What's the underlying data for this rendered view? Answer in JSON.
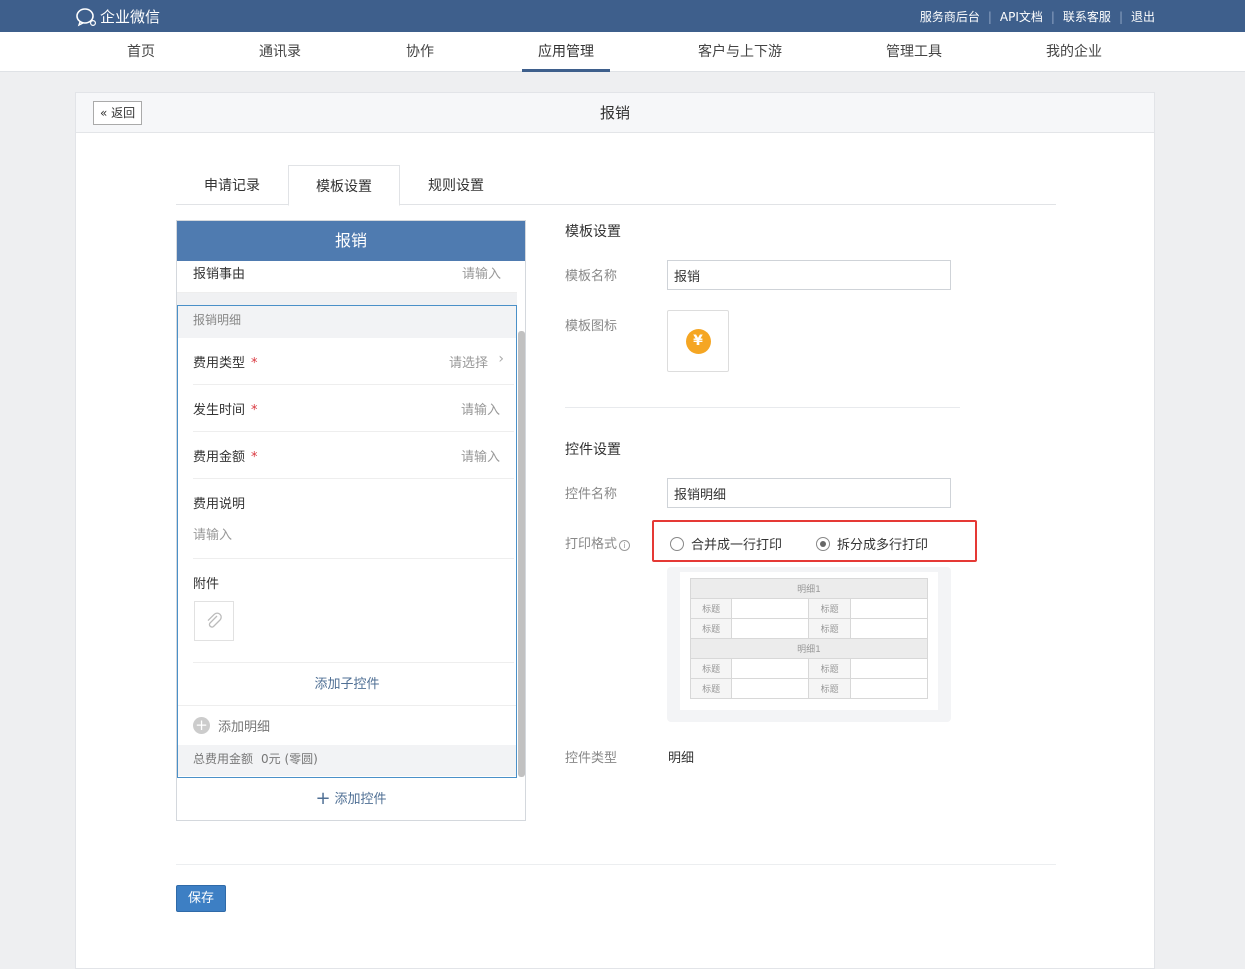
{
  "topbar": {
    "logo_text": "企业微信",
    "links": [
      "服务商后台",
      "API文档",
      "联系客服",
      "退出"
    ],
    "separator": "|"
  },
  "nav": {
    "items": [
      "首页",
      "通讯录",
      "协作",
      "应用管理",
      "客户与上下游",
      "管理工具",
      "我的企业"
    ],
    "active": "应用管理"
  },
  "page": {
    "back_label": "返回",
    "title": "报销"
  },
  "tabs": [
    "申请记录",
    "模板设置",
    "规则设置"
  ],
  "preview": {
    "header": "报销",
    "reason_label": "报销事由",
    "reason_placeholder": "请输入",
    "detail_title": "报销明细",
    "fields": [
      {
        "label": "费用类型",
        "required": "*",
        "placeholder": "请选择"
      },
      {
        "label": "发生时间",
        "required": "*",
        "placeholder": "请输入"
      },
      {
        "label": "费用金额",
        "required": "*",
        "placeholder": "请输入"
      }
    ],
    "desc_label": "费用说明",
    "desc_placeholder": "请输入",
    "attachment_label": "附件",
    "add_sub_control": "添加子控件",
    "add_detail": "添加明细",
    "total_label": "总费用金额",
    "total_value": "0元 (零圆)",
    "add_control": "添加控件"
  },
  "template_settings": {
    "section_title": "模板设置",
    "name_label": "模板名称",
    "name_value": "报销",
    "icon_label": "模板图标",
    "icon_glyph": "¥",
    "icon_color": "#f5a623"
  },
  "control_settings": {
    "section_title": "控件设置",
    "name_label": "控件名称",
    "name_value": "报销明细",
    "print_label": "打印格式",
    "print_options": [
      "合并成一行打印",
      "拆分成多行打印"
    ],
    "print_selected": "拆分成多行打印",
    "print_preview": {
      "group_title": "明细1",
      "cell_label": "标题"
    },
    "type_label": "控件类型",
    "type_value": "明细"
  },
  "save_label": "保存"
}
